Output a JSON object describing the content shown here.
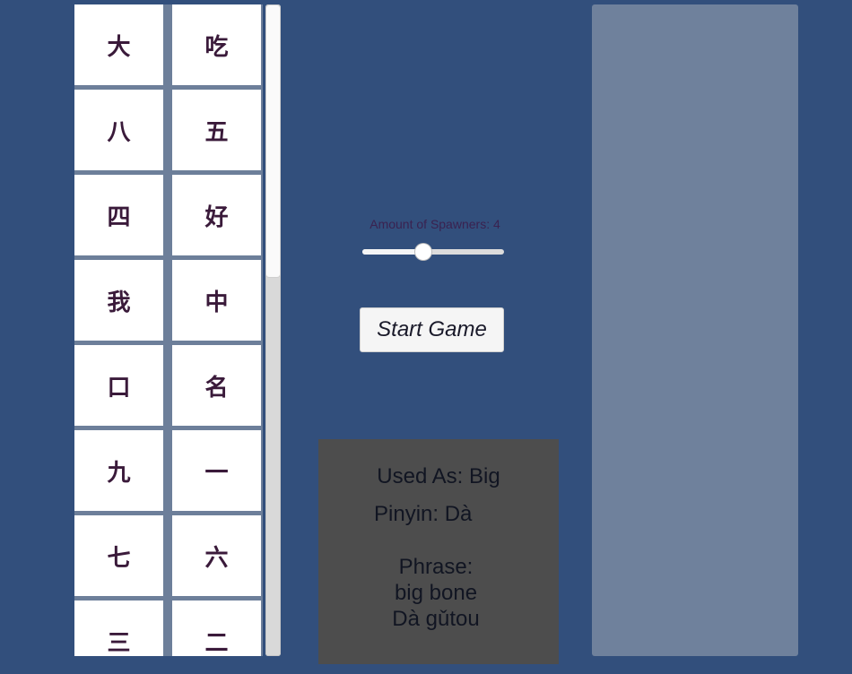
{
  "characters": [
    "大",
    "吃",
    "八",
    "五",
    "四",
    "好",
    "我",
    "中",
    "口",
    "名",
    "九",
    "一",
    "七",
    "六",
    "三",
    "二"
  ],
  "spawner": {
    "label": "Amount of Spawners: 4",
    "value_fraction": 0.43
  },
  "start_button": {
    "label": "Start Game"
  },
  "info": {
    "used_as": "Used As: Big",
    "pinyin": "Pinyin: Dà",
    "phrase_label": "Phrase:",
    "phrase_english": "big bone",
    "phrase_pinyin": "Dà gǔtou"
  },
  "colors": {
    "background": "#324f7c",
    "tile": "#ffffff",
    "character_text": "#3a1a3a",
    "info_panel": "#4d4d4d",
    "side_panel": "#6f819c"
  }
}
